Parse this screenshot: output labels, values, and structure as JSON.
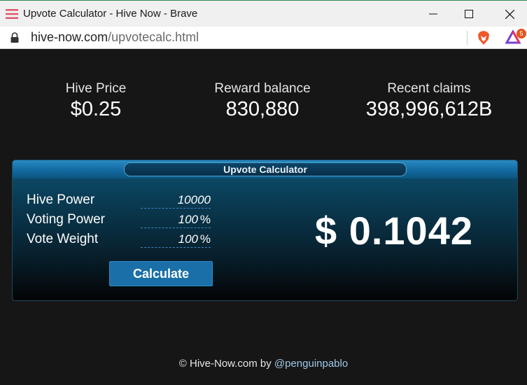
{
  "window": {
    "title": "Upvote Calculator - Hive Now - Brave",
    "url_host": "hive-now.com",
    "url_path": "/upvotecalc.html",
    "rewards_badge": "5"
  },
  "stats": {
    "hive_price": {
      "label": "Hive Price",
      "value": "$0.25"
    },
    "reward_balance": {
      "label": "Reward balance",
      "value": "830,880"
    },
    "recent_claims": {
      "label": "Recent claims",
      "value": "398,996,612B"
    }
  },
  "calculator": {
    "title": "Upvote Calculator",
    "hive_power": {
      "label": "Hive Power",
      "value": "10000"
    },
    "voting_power": {
      "label": "Voting Power",
      "value": "100",
      "unit": "%"
    },
    "vote_weight": {
      "label": "Vote Weight",
      "value": "100",
      "unit": "%"
    },
    "button_label": "Calculate",
    "result": "$ 0.1042"
  },
  "footer": {
    "text": "© Hive-Now.com by ",
    "author": "@penguinpablo"
  },
  "icons": [
    "app-menu-icon",
    "minimize-icon",
    "maximize-icon",
    "close-icon",
    "lock-icon",
    "brave-shield-icon",
    "brave-rewards-icon"
  ]
}
